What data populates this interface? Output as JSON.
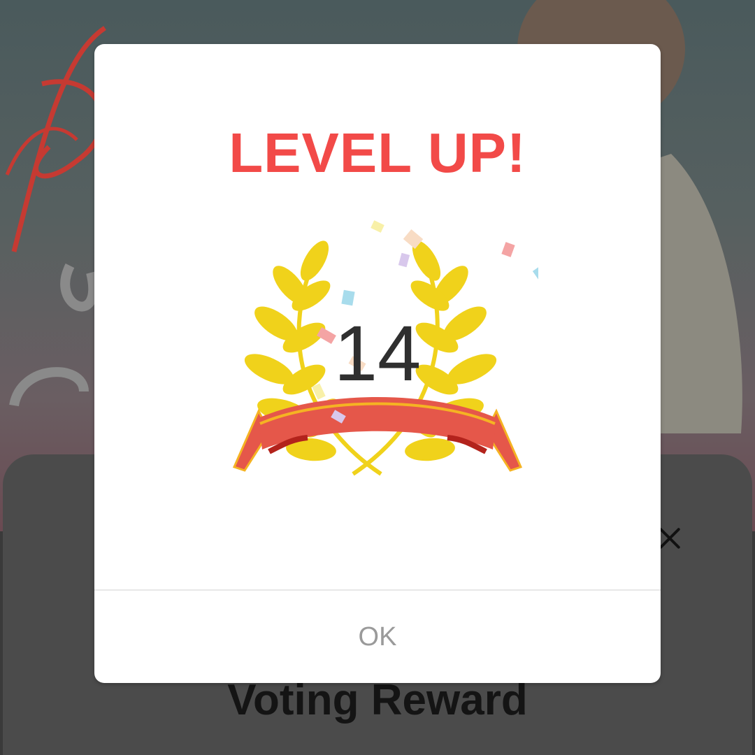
{
  "dialog": {
    "title": "LEVEL UP!",
    "level": "14",
    "ok_label": "OK"
  },
  "background_sheet": {
    "title": "Voting Reward"
  },
  "icons": {
    "laurel": "laurel-wreath-with-ribbon",
    "close": "close-icon"
  },
  "colors": {
    "title_red": "#f24a48",
    "laurel_gold": "#f0d21b",
    "ribbon_red": "#e5574a",
    "ribbon_trim": "#f5b323"
  }
}
